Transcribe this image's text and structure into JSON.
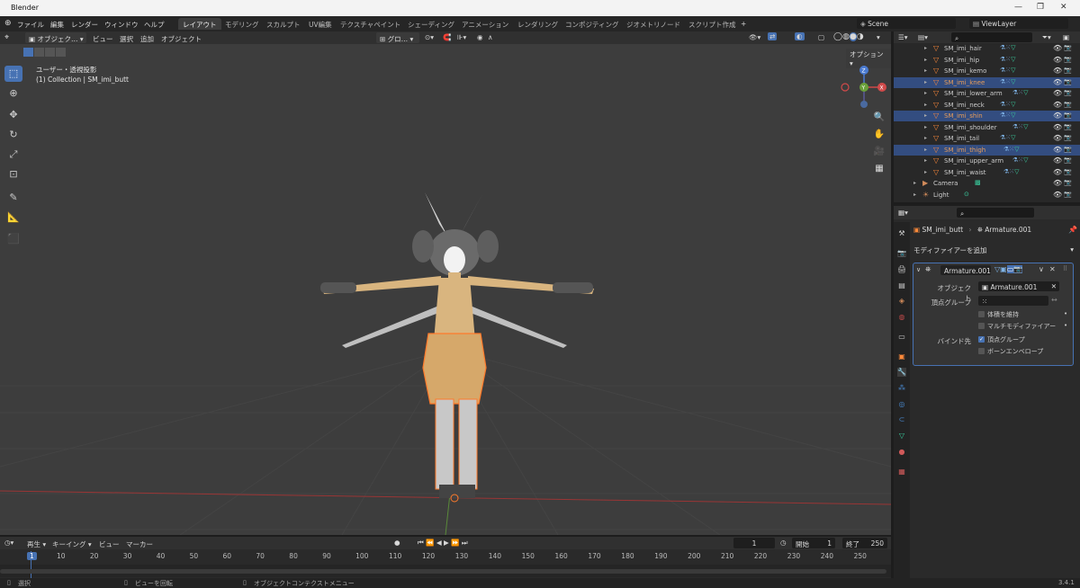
{
  "titlebar": {
    "title": "Blender"
  },
  "menu": {
    "items": [
      "ファイル",
      "編集",
      "レンダー",
      "ウィンドウ",
      "ヘルプ"
    ]
  },
  "workspaces": [
    "レイアウト",
    "モデリング",
    "スカルプト",
    "UV編集",
    "テクスチャペイント",
    "シェーディング",
    "アニメーション",
    "レンダリング",
    "コンポジティング",
    "ジオメトリノード",
    "スクリプト作成"
  ],
  "scene": {
    "name": "Scene",
    "view_layer": "ViewLayer"
  },
  "viewport_header": {
    "mode": "オブジェク…",
    "menus": [
      "ビュー",
      "選択",
      "追加",
      "オブジェクト"
    ],
    "transform": "グロ…",
    "options": "オプション"
  },
  "viewport": {
    "view_name": "ユーザー・透視投影",
    "collection": "(1) Collection | SM_imi_butt",
    "axes": {
      "z": "Z",
      "y": "Y",
      "x": "X"
    }
  },
  "outliner": {
    "rows": [
      {
        "name": "SM_imi_hair",
        "sel": false,
        "hl": false
      },
      {
        "name": "SM_imi_hip",
        "sel": false,
        "hl": false
      },
      {
        "name": "SM_imi_kemo",
        "sel": false,
        "hl": false
      },
      {
        "name": "SM_imi_knee",
        "sel": true,
        "hl": true
      },
      {
        "name": "SM_imi_lower_arm",
        "sel": false,
        "hl": false
      },
      {
        "name": "SM_imi_neck",
        "sel": false,
        "hl": false
      },
      {
        "name": "SM_imi_shin",
        "sel": true,
        "hl": true
      },
      {
        "name": "SM_imi_shoulder",
        "sel": false,
        "hl": false
      },
      {
        "name": "SM_imi_tail",
        "sel": false,
        "hl": false
      },
      {
        "name": "SM_imi_thigh",
        "sel": true,
        "hl": true
      },
      {
        "name": "SM_imi_upper_arm",
        "sel": false,
        "hl": false
      },
      {
        "name": "SM_imi_waist",
        "sel": false,
        "hl": false
      },
      {
        "name": "Camera",
        "sel": false,
        "hl": false
      },
      {
        "name": "Light",
        "sel": false,
        "hl": false
      }
    ]
  },
  "properties": {
    "breadcrumb_object": "SM_imi_butt",
    "breadcrumb_modifier": "Armature.001",
    "add_modifier": "モディファイアーを追加",
    "modifier_name": "Armature.001",
    "object_label": "オブジェクト",
    "object_value": "Armature.001",
    "vertex_group_label": "頂点グループ",
    "preserve_volume": "体積を維持",
    "multi_modifier": "マルチモディファイアー",
    "bind_to": "バインド先",
    "vertex_groups": "頂点グループ",
    "bone_envelopes": "ボーンエンベロープ"
  },
  "timeline": {
    "menus": [
      "再生",
      "キーイング",
      "ビュー",
      "マーカー"
    ],
    "current_frame": "1",
    "start_label": "開始",
    "start": "1",
    "end_label": "終了",
    "end": "250",
    "ticks": [
      "1",
      "10",
      "20",
      "30",
      "40",
      "50",
      "60",
      "70",
      "80",
      "90",
      "100",
      "110",
      "120",
      "130",
      "140",
      "150",
      "160",
      "170",
      "180",
      "190",
      "200",
      "210",
      "220",
      "230",
      "240",
      "250"
    ]
  },
  "statusbar": {
    "select": "選択",
    "rotate": "ビューを回転",
    "context": "オブジェクトコンテクストメニュー",
    "version": "3.4.1"
  }
}
